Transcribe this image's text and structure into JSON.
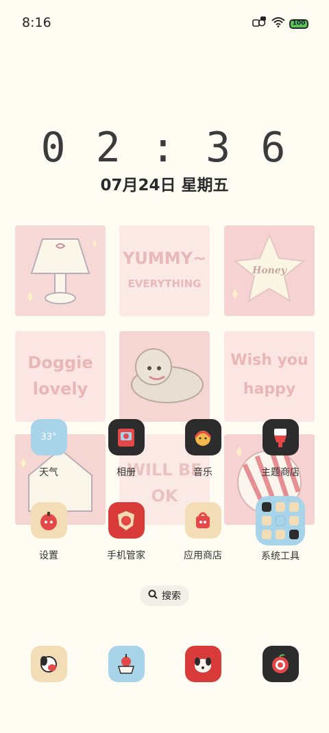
{
  "status_bar": {
    "time": "8:16",
    "battery": "100"
  },
  "lock_clock": {
    "time": "0 2 : 3 6",
    "date": "07月24日 星期五"
  },
  "wallpaper": {
    "tiles": [
      {
        "text": ""
      },
      {
        "text": "YUMMY~",
        "sub": "EVERYTHING"
      },
      {
        "text": "Honey"
      },
      {
        "text": "Doggie",
        "sub": "lovely"
      },
      {
        "text": ""
      },
      {
        "text": "Wish you",
        "sub": "happy"
      },
      {
        "text": ""
      },
      {
        "text": "WILL BE",
        "sub": "OK"
      },
      {
        "text": ""
      }
    ]
  },
  "apps": [
    {
      "label": "天气",
      "icon": "weather-icon",
      "icon_text": "33°"
    },
    {
      "label": "相册",
      "icon": "gallery-icon"
    },
    {
      "label": "音乐",
      "icon": "music-icon"
    },
    {
      "label": "主题商店",
      "icon": "theme-store-icon"
    },
    {
      "label": "设置",
      "icon": "settings-icon"
    },
    {
      "label": "手机管家",
      "icon": "phone-manager-icon"
    },
    {
      "label": "应用商店",
      "icon": "app-store-icon"
    },
    {
      "label": "系统工具",
      "icon": "system-tools-folder-icon"
    }
  ],
  "search": {
    "label": "搜索"
  },
  "dock": [
    {
      "icon": "phone-icon"
    },
    {
      "icon": "messages-icon"
    },
    {
      "icon": "browser-icon"
    },
    {
      "icon": "camera-icon"
    }
  ],
  "colors": {
    "background": "#fffcf4",
    "tile_pink": "#f6d9d6",
    "tile_light": "#fbe9e6",
    "accent_red": "#d93b3b",
    "dark_icon": "#2c2c2c",
    "light_blue": "#a8d4ea",
    "beige": "#f3ddb6"
  }
}
